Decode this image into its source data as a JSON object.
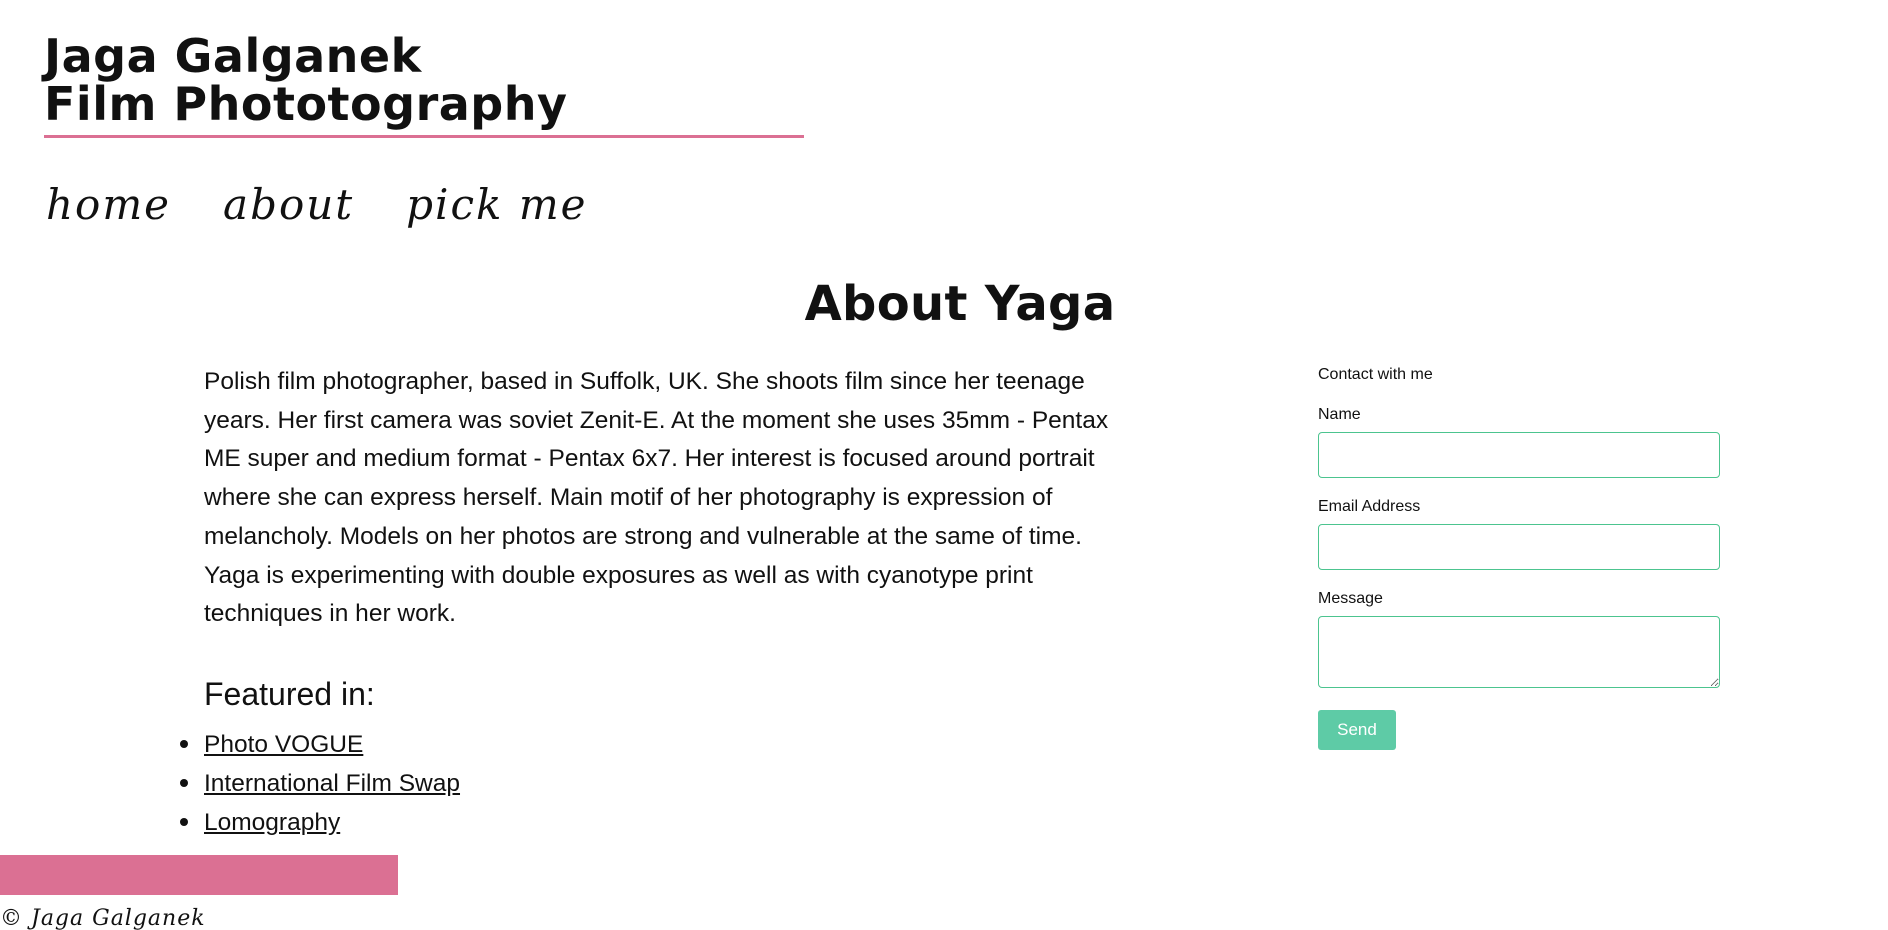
{
  "header": {
    "title_line1": "Jaga Galganek",
    "title_line2": "Film Phototography"
  },
  "nav": {
    "items": [
      {
        "label": "home"
      },
      {
        "label": "about"
      },
      {
        "label": "pick me"
      }
    ]
  },
  "main": {
    "heading": "About Yaga",
    "bio": "Polish film photographer, based in Suffolk, UK. She shoots film since her teenage years. Her first camera was soviet Zenit-E. At the moment she uses 35mm - Pentax ME super and medium format - Pentax 6x7. Her interest is focused around portrait where she can express herself. Main motif of her photography is expression of melancholy. Models on her photos are strong and vulnerable at the same of time. Yaga is experimenting with double exposures as well as with cyanotype print techniques in her work.",
    "featured_heading": "Featured in:",
    "featured": [
      {
        "label": "Photo VOGUE"
      },
      {
        "label": "International Film Swap"
      },
      {
        "label": "Lomography"
      }
    ]
  },
  "contact": {
    "title": "Contact with me",
    "name_label": "Name",
    "name_value": "",
    "email_label": "Email Address",
    "email_value": "",
    "message_label": "Message",
    "message_value": "",
    "send_label": "Send"
  },
  "footer": {
    "copyright": "© Jaga Galganek"
  },
  "colors": {
    "accent_pink": "#db7093",
    "field_border": "#4cc48f",
    "send_button": "#5ecba6"
  }
}
